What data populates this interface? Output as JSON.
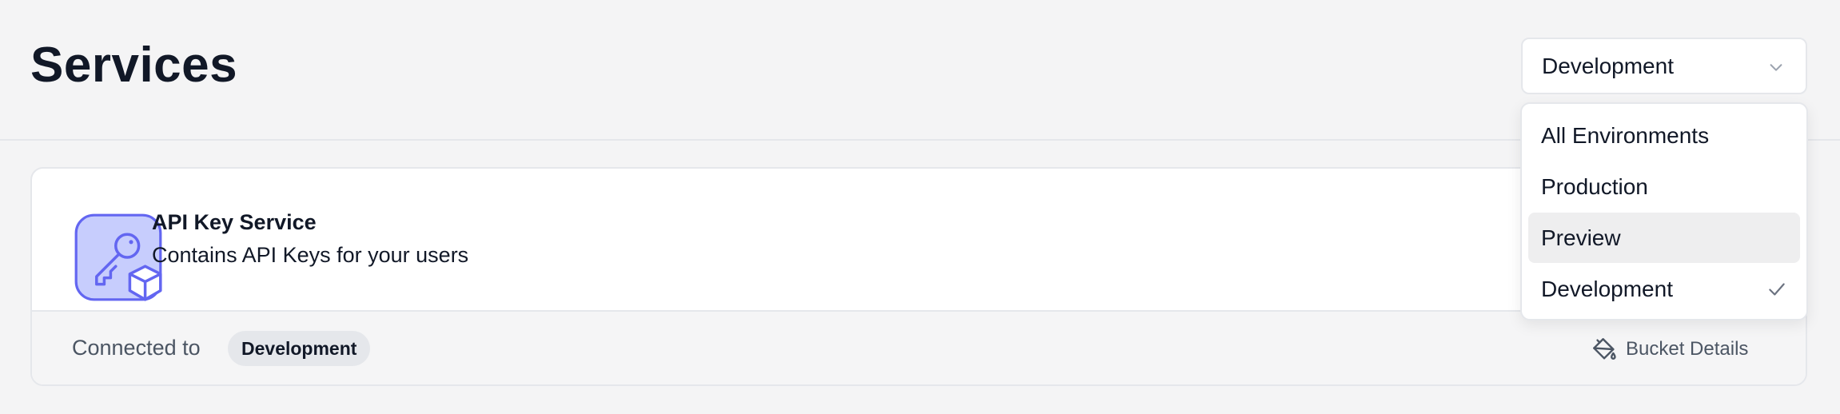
{
  "header": {
    "title": "Services",
    "environment_select": {
      "selected": "Development"
    }
  },
  "dropdown": {
    "options": [
      {
        "label": "All Environments",
        "highlighted": false,
        "checked": false
      },
      {
        "label": "Production",
        "highlighted": false,
        "checked": false
      },
      {
        "label": "Preview",
        "highlighted": true,
        "checked": false
      },
      {
        "label": "Development",
        "highlighted": false,
        "checked": true
      }
    ]
  },
  "service_card": {
    "icon": "key-box-icon",
    "name": "API Key Service",
    "description": "Contains API Keys for your users",
    "connected_label": "Connected to",
    "connected_env": "Development",
    "bucket_link_label": "Bucket Details",
    "bucket_link_icon": "paint-bucket-icon"
  },
  "colors": {
    "background": "#f4f4f5",
    "icon_accent": "#6366f1",
    "icon_fill": "#c7cdfd",
    "badge_bg": "#e5e7eb",
    "highlight_bg": "#eeeeef"
  }
}
